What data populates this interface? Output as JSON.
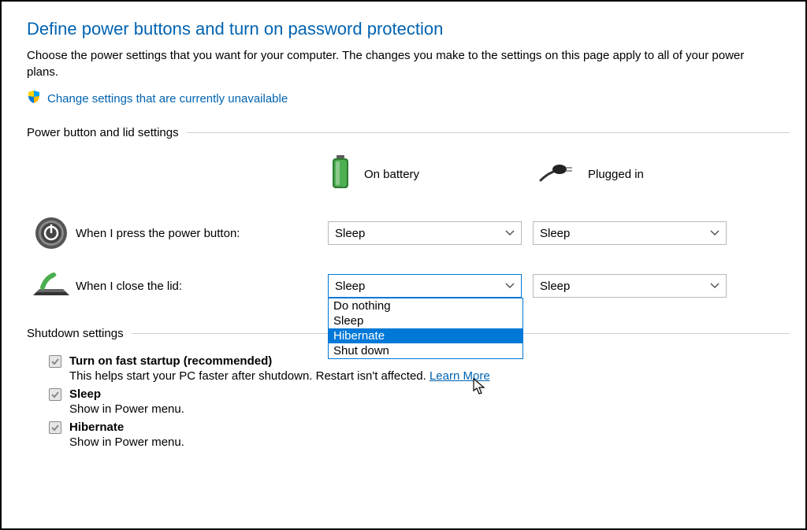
{
  "title": "Define power buttons and turn on password protection",
  "description": "Choose the power settings that you want for your computer. The changes you make to the settings on this page apply to all of your power plans.",
  "change_link": "Change settings that are currently unavailable",
  "section1": {
    "label": "Power button and lid settings",
    "col_battery": "On battery",
    "col_plugged": "Plugged in",
    "rows": [
      {
        "label": "When I press the power button:",
        "battery": "Sleep",
        "plugged": "Sleep"
      },
      {
        "label": "When I close the lid:",
        "battery": "Sleep",
        "plugged": "Sleep"
      }
    ]
  },
  "dropdown": {
    "options": [
      "Do nothing",
      "Sleep",
      "Hibernate",
      "Shut down"
    ],
    "highlighted": "Hibernate"
  },
  "section2": {
    "label": "Shutdown settings",
    "items": [
      {
        "label": "Turn on fast startup (recommended)",
        "sub": "This helps start your PC faster after shutdown. Restart isn't affected. ",
        "link": "Learn More",
        "checked": true
      },
      {
        "label": "Sleep",
        "sub": "Show in Power menu.",
        "checked": true
      },
      {
        "label": "Hibernate",
        "sub": "Show in Power menu.",
        "checked": true
      }
    ]
  }
}
